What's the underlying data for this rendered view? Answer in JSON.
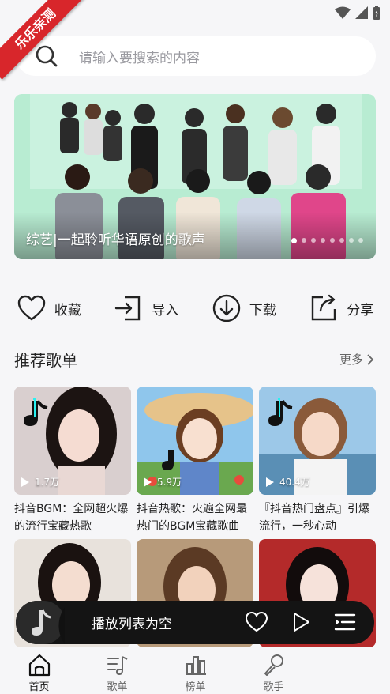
{
  "ribbon": "乐乐亲测",
  "search": {
    "placeholder": "请输入要搜索的内容"
  },
  "banner": {
    "caption": "综艺|一起聆听华语原创的歌声",
    "dots_total": 8,
    "dots_active": 0
  },
  "actions": [
    {
      "icon": "heart-icon",
      "label": "收藏"
    },
    {
      "icon": "import-icon",
      "label": "导入"
    },
    {
      "icon": "download-icon",
      "label": "下载"
    },
    {
      "icon": "share-icon",
      "label": "分享"
    }
  ],
  "section": {
    "title": "推荐歌单",
    "more": "更多"
  },
  "playlists": [
    {
      "title": "抖音BGM：全网超火爆的流行宝藏热歌",
      "plays": "1.7万"
    },
    {
      "title": "抖音热歌：火遍全网最热门的BGM宝藏歌曲",
      "plays": "5.9万"
    },
    {
      "title": "『抖音热门盘点』引爆流行，一秒心动",
      "plays": "40.4万"
    },
    {
      "title": "",
      "plays": ""
    },
    {
      "title": "",
      "plays": ""
    },
    {
      "title": "",
      "plays": ""
    }
  ],
  "player": {
    "label": "播放列表为空"
  },
  "tabs": [
    {
      "icon": "home-icon",
      "label": "首页",
      "active": true
    },
    {
      "icon": "playlist-icon",
      "label": "歌单",
      "active": false
    },
    {
      "icon": "chart-icon",
      "label": "榜单",
      "active": false
    },
    {
      "icon": "singer-icon",
      "label": "歌手",
      "active": false
    }
  ],
  "colors": {
    "ribbon": "#d8262b",
    "player_bg": "#141414",
    "banner_green": "#9de7c5"
  }
}
